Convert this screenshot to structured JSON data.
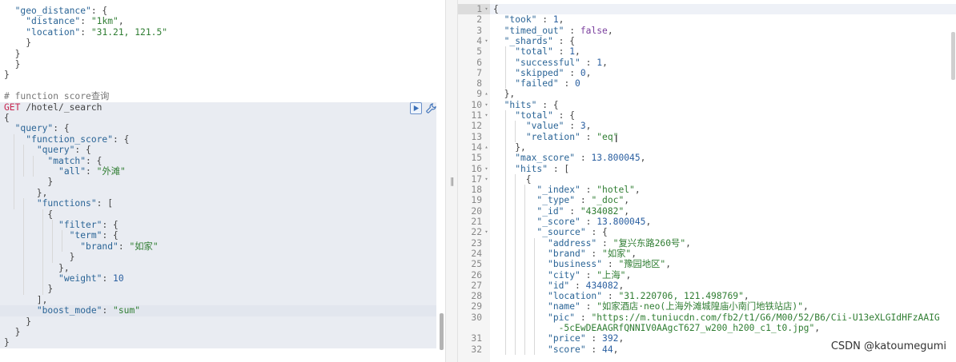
{
  "request_pane": {
    "lines": [
      [
        [
          "p",
          "  "
        ],
        [
          "key",
          "\"geo_distance\""
        ],
        [
          "p",
          ": {"
        ]
      ],
      [
        [
          "p",
          "    "
        ],
        [
          "key",
          "\"distance\""
        ],
        [
          "p",
          ": "
        ],
        [
          "str",
          "\"1km\""
        ],
        [
          "p",
          ","
        ]
      ],
      [
        [
          "p",
          "    "
        ],
        [
          "key",
          "\"location\""
        ],
        [
          "p",
          ": "
        ],
        [
          "str",
          "\"31.21, 121.5\""
        ]
      ],
      [
        [
          "p",
          "    }"
        ]
      ],
      [
        [
          "p",
          "  }"
        ]
      ],
      [
        [
          "p",
          "  }"
        ]
      ],
      [
        [
          "p",
          "}"
        ]
      ],
      [
        [
          "p",
          ""
        ]
      ],
      [
        [
          "com",
          "# function score查询"
        ]
      ],
      [
        [
          "method",
          "GET"
        ],
        [
          "p",
          " /hotel/_search"
        ]
      ],
      [
        [
          "p",
          "{"
        ]
      ],
      [
        [
          "p",
          "  "
        ],
        [
          "key",
          "\"query\""
        ],
        [
          "p",
          ": {"
        ]
      ],
      [
        [
          "p",
          "    "
        ],
        [
          "key",
          "\"function_score\""
        ],
        [
          "p",
          ": {"
        ]
      ],
      [
        [
          "p",
          "      "
        ],
        [
          "key",
          "\"query\""
        ],
        [
          "p",
          ": {"
        ]
      ],
      [
        [
          "p",
          "        "
        ],
        [
          "key",
          "\"match\""
        ],
        [
          "p",
          ": {"
        ]
      ],
      [
        [
          "p",
          "          "
        ],
        [
          "key",
          "\"all\""
        ],
        [
          "p",
          ": "
        ],
        [
          "str",
          "\"外滩\""
        ]
      ],
      [
        [
          "p",
          "        }"
        ]
      ],
      [
        [
          "p",
          "      },"
        ]
      ],
      [
        [
          "p",
          "      "
        ],
        [
          "key",
          "\"functions\""
        ],
        [
          "p",
          ": ["
        ]
      ],
      [
        [
          "p",
          "        {"
        ]
      ],
      [
        [
          "p",
          "          "
        ],
        [
          "key",
          "\"filter\""
        ],
        [
          "p",
          ": {"
        ]
      ],
      [
        [
          "p",
          "            "
        ],
        [
          "key",
          "\"term\""
        ],
        [
          "p",
          ": {"
        ]
      ],
      [
        [
          "p",
          "              "
        ],
        [
          "key",
          "\"brand\""
        ],
        [
          "p",
          ": "
        ],
        [
          "str",
          "\"如家\""
        ]
      ],
      [
        [
          "p",
          "            }"
        ]
      ],
      [
        [
          "p",
          "          },"
        ]
      ],
      [
        [
          "p",
          "          "
        ],
        [
          "key",
          "\"weight\""
        ],
        [
          "p",
          ": "
        ],
        [
          "num",
          "10"
        ]
      ],
      [
        [
          "p",
          "        }"
        ]
      ],
      [
        [
          "p",
          "      ],"
        ]
      ],
      [
        [
          "p",
          "      "
        ],
        [
          "key",
          "\"boost_mode\""
        ],
        [
          "p",
          ": "
        ],
        [
          "str",
          "\"sum\""
        ]
      ],
      [
        [
          "p",
          "    }"
        ]
      ],
      [
        [
          "p",
          "  }"
        ]
      ],
      [
        [
          "p",
          "}"
        ]
      ]
    ]
  },
  "response_pane": {
    "lines": [
      {
        "n": "1",
        "f": "▾",
        "t": [
          [
            "p",
            "{"
          ]
        ]
      },
      {
        "n": "2",
        "f": "",
        "t": [
          [
            "p",
            "  "
          ],
          [
            "key",
            "\"took\""
          ],
          [
            "p",
            " : "
          ],
          [
            "num",
            "1"
          ],
          [
            "p",
            ","
          ]
        ]
      },
      {
        "n": "3",
        "f": "",
        "t": [
          [
            "p",
            "  "
          ],
          [
            "key",
            "\"timed_out\""
          ],
          [
            "p",
            " : "
          ],
          [
            "kw",
            "false"
          ],
          [
            "p",
            ","
          ]
        ]
      },
      {
        "n": "4",
        "f": "▾",
        "t": [
          [
            "p",
            "  "
          ],
          [
            "key",
            "\"_shards\""
          ],
          [
            "p",
            " : {"
          ]
        ]
      },
      {
        "n": "5",
        "f": "",
        "t": [
          [
            "p",
            "    "
          ],
          [
            "key",
            "\"total\""
          ],
          [
            "p",
            " : "
          ],
          [
            "num",
            "1"
          ],
          [
            "p",
            ","
          ]
        ]
      },
      {
        "n": "6",
        "f": "",
        "t": [
          [
            "p",
            "    "
          ],
          [
            "key",
            "\"successful\""
          ],
          [
            "p",
            " : "
          ],
          [
            "num",
            "1"
          ],
          [
            "p",
            ","
          ]
        ]
      },
      {
        "n": "7",
        "f": "",
        "t": [
          [
            "p",
            "    "
          ],
          [
            "key",
            "\"skipped\""
          ],
          [
            "p",
            " : "
          ],
          [
            "num",
            "0"
          ],
          [
            "p",
            ","
          ]
        ]
      },
      {
        "n": "8",
        "f": "",
        "t": [
          [
            "p",
            "    "
          ],
          [
            "key",
            "\"failed\""
          ],
          [
            "p",
            " : "
          ],
          [
            "num",
            "0"
          ]
        ]
      },
      {
        "n": "9",
        "f": "▴",
        "t": [
          [
            "p",
            "  },"
          ]
        ]
      },
      {
        "n": "10",
        "f": "▾",
        "t": [
          [
            "p",
            "  "
          ],
          [
            "key",
            "\"hits\""
          ],
          [
            "p",
            " : {"
          ]
        ]
      },
      {
        "n": "11",
        "f": "▾",
        "t": [
          [
            "p",
            "    "
          ],
          [
            "key",
            "\"total\""
          ],
          [
            "p",
            " : {"
          ]
        ]
      },
      {
        "n": "12",
        "f": "",
        "t": [
          [
            "p",
            "      "
          ],
          [
            "key",
            "\"value\""
          ],
          [
            "p",
            " : "
          ],
          [
            "num",
            "3"
          ],
          [
            "p",
            ","
          ]
        ]
      },
      {
        "n": "13",
        "f": "",
        "t": [
          [
            "p",
            "      "
          ],
          [
            "key",
            "\"relation\""
          ],
          [
            "p",
            " : "
          ],
          [
            "str",
            "\"eq\""
          ]
        ]
      },
      {
        "n": "14",
        "f": "▴",
        "t": [
          [
            "p",
            "    },"
          ]
        ]
      },
      {
        "n": "15",
        "f": "",
        "t": [
          [
            "p",
            "    "
          ],
          [
            "key",
            "\"max_score\""
          ],
          [
            "p",
            " : "
          ],
          [
            "num",
            "13.800045"
          ],
          [
            "p",
            ","
          ]
        ]
      },
      {
        "n": "16",
        "f": "▾",
        "t": [
          [
            "p",
            "    "
          ],
          [
            "key",
            "\"hits\""
          ],
          [
            "p",
            " : ["
          ]
        ]
      },
      {
        "n": "17",
        "f": "▾",
        "t": [
          [
            "p",
            "      {"
          ]
        ]
      },
      {
        "n": "18",
        "f": "",
        "t": [
          [
            "p",
            "        "
          ],
          [
            "key",
            "\"_index\""
          ],
          [
            "p",
            " : "
          ],
          [
            "str",
            "\"hotel\""
          ],
          [
            "p",
            ","
          ]
        ]
      },
      {
        "n": "19",
        "f": "",
        "t": [
          [
            "p",
            "        "
          ],
          [
            "key",
            "\"_type\""
          ],
          [
            "p",
            " : "
          ],
          [
            "str",
            "\"_doc\""
          ],
          [
            "p",
            ","
          ]
        ]
      },
      {
        "n": "20",
        "f": "",
        "t": [
          [
            "p",
            "        "
          ],
          [
            "key",
            "\"_id\""
          ],
          [
            "p",
            " : "
          ],
          [
            "str",
            "\"434082\""
          ],
          [
            "p",
            ","
          ]
        ]
      },
      {
        "n": "21",
        "f": "",
        "t": [
          [
            "p",
            "        "
          ],
          [
            "key",
            "\"_score\""
          ],
          [
            "p",
            " : "
          ],
          [
            "num",
            "13.800045"
          ],
          [
            "p",
            ","
          ]
        ]
      },
      {
        "n": "22",
        "f": "▾",
        "t": [
          [
            "p",
            "        "
          ],
          [
            "key",
            "\"_source\""
          ],
          [
            "p",
            " : {"
          ]
        ]
      },
      {
        "n": "23",
        "f": "",
        "t": [
          [
            "p",
            "          "
          ],
          [
            "key",
            "\"address\""
          ],
          [
            "p",
            " : "
          ],
          [
            "str",
            "\"复兴东路260号\""
          ],
          [
            "p",
            ","
          ]
        ]
      },
      {
        "n": "24",
        "f": "",
        "t": [
          [
            "p",
            "          "
          ],
          [
            "key",
            "\"brand\""
          ],
          [
            "p",
            " : "
          ],
          [
            "str",
            "\"如家\""
          ],
          [
            "p",
            ","
          ]
        ]
      },
      {
        "n": "25",
        "f": "",
        "t": [
          [
            "p",
            "          "
          ],
          [
            "key",
            "\"business\""
          ],
          [
            "p",
            " : "
          ],
          [
            "str",
            "\"豫园地区\""
          ],
          [
            "p",
            ","
          ]
        ]
      },
      {
        "n": "26",
        "f": "",
        "t": [
          [
            "p",
            "          "
          ],
          [
            "key",
            "\"city\""
          ],
          [
            "p",
            " : "
          ],
          [
            "str",
            "\"上海\""
          ],
          [
            "p",
            ","
          ]
        ]
      },
      {
        "n": "27",
        "f": "",
        "t": [
          [
            "p",
            "          "
          ],
          [
            "key",
            "\"id\""
          ],
          [
            "p",
            " : "
          ],
          [
            "num",
            "434082"
          ],
          [
            "p",
            ","
          ]
        ]
      },
      {
        "n": "28",
        "f": "",
        "t": [
          [
            "p",
            "          "
          ],
          [
            "key",
            "\"location\""
          ],
          [
            "p",
            " : "
          ],
          [
            "str",
            "\"31.220706, 121.498769\""
          ],
          [
            "p",
            ","
          ]
        ]
      },
      {
        "n": "29",
        "f": "",
        "t": [
          [
            "p",
            "          "
          ],
          [
            "key",
            "\"name\""
          ],
          [
            "p",
            " : "
          ],
          [
            "str",
            "\"如家酒店·neo(上海外滩城隍庙小南门地铁站店)\""
          ],
          [
            "p",
            ","
          ]
        ]
      },
      {
        "n": "30",
        "f": "",
        "t": [
          [
            "p",
            "          "
          ],
          [
            "key",
            "\"pic\""
          ],
          [
            "p",
            " : "
          ],
          [
            "str",
            "\"https://m.tuniucdn.com/fb2/t1/G6/M00/52/B6/Cii-U13eXLGIdHFzAAIG"
          ]
        ]
      },
      {
        "n": "",
        "f": "",
        "t": [
          [
            "str",
            "            -5cEwDEAAGRfQNNIV0AAgcT627_w200_h200_c1_t0.jpg\""
          ],
          [
            "p",
            ","
          ]
        ]
      },
      {
        "n": "31",
        "f": "",
        "t": [
          [
            "p",
            "          "
          ],
          [
            "key",
            "\"price\""
          ],
          [
            "p",
            " : "
          ],
          [
            "num",
            "392"
          ],
          [
            "p",
            ","
          ]
        ]
      },
      {
        "n": "32",
        "f": "",
        "t": [
          [
            "p",
            "          "
          ],
          [
            "key",
            "\"score\""
          ],
          [
            "p",
            " : "
          ],
          [
            "num",
            "44"
          ],
          [
            "p",
            ","
          ]
        ]
      }
    ]
  },
  "watermark": "CSDN @katoumegumi",
  "icons": {
    "run": "play-icon",
    "settings": "wrench-icon",
    "divider": "resize-handle-icon"
  }
}
